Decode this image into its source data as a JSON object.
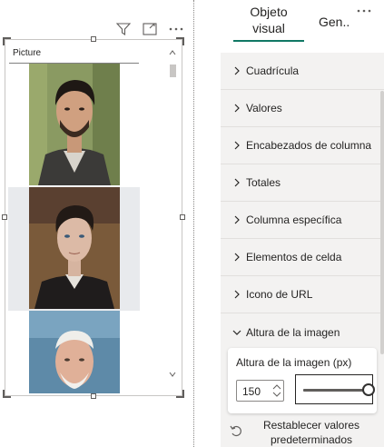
{
  "visual": {
    "header_icons": [
      "filter-icon",
      "focus-mode-icon",
      "more-options-icon"
    ],
    "table": {
      "column_header": "Picture",
      "rows": [
        {
          "image": "portrait-photo-1"
        },
        {
          "image": "portrait-photo-2"
        },
        {
          "image": "portrait-photo-3"
        }
      ]
    }
  },
  "format_pane": {
    "tabs": [
      {
        "label": "Objeto visual",
        "active": true
      },
      {
        "label": "Gen.."
      }
    ],
    "sections": [
      {
        "label": "Cuadrícula"
      },
      {
        "label": "Valores"
      },
      {
        "label": "Encabezados de columna"
      },
      {
        "label": "Totales"
      },
      {
        "label": "Columna específica"
      },
      {
        "label": "Elementos de celda"
      },
      {
        "label": "Icono de URL"
      },
      {
        "label": "Altura de la imagen",
        "expanded": true
      }
    ],
    "image_height": {
      "label": "Altura de la imagen (px)",
      "value": "150",
      "slider_fraction": 1.0
    },
    "reset_label": "Restablecer valores predeterminados"
  },
  "colors": {
    "accent": "#117865",
    "pane_bg": "#f3f2f1",
    "alt_row": "#e8eaed"
  }
}
